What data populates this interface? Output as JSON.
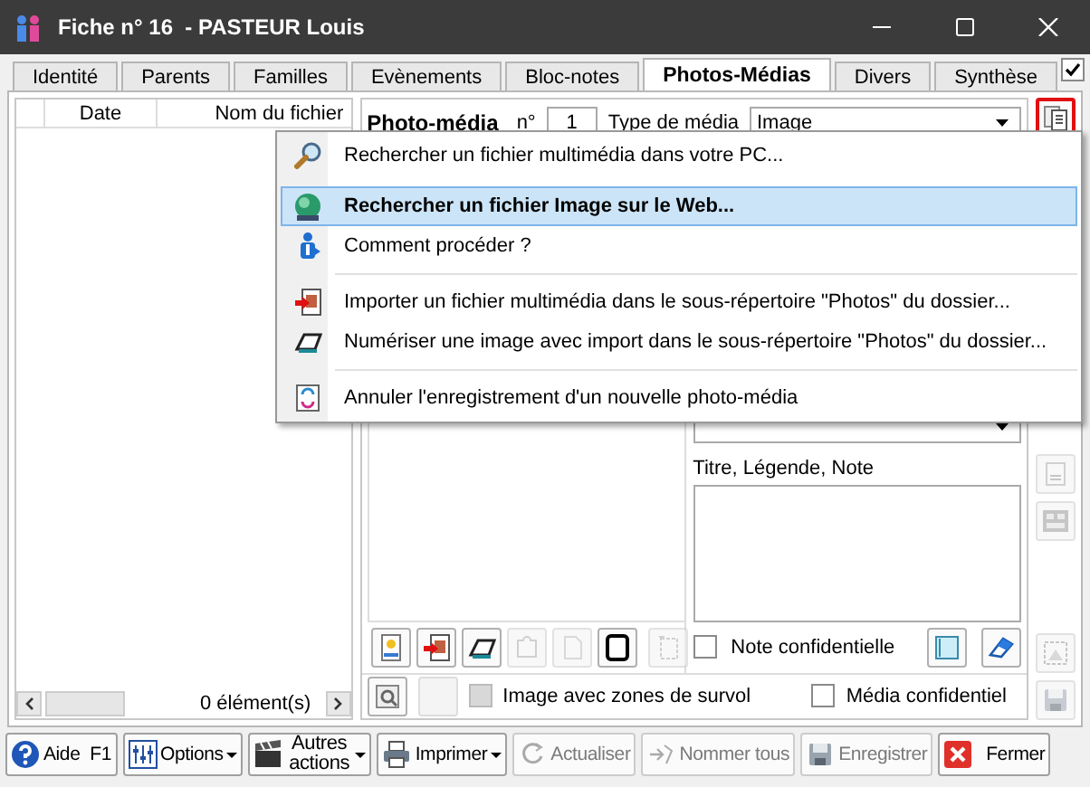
{
  "window": {
    "title": "Fiche n° 16  - PASTEUR Louis"
  },
  "tabs": [
    {
      "label": "Identité",
      "selected": false
    },
    {
      "label": "Parents",
      "selected": false
    },
    {
      "label": "Familles",
      "selected": false
    },
    {
      "label": "Evènements",
      "selected": false
    },
    {
      "label": "Bloc-notes",
      "selected": false
    },
    {
      "label": "Photos-Médias",
      "selected": true
    },
    {
      "label": "Divers",
      "selected": false
    },
    {
      "label": "Synthèse",
      "selected": false
    }
  ],
  "top_checkbox": {
    "checked": true
  },
  "list": {
    "columns": [
      "Date",
      "Nom du fichier"
    ],
    "count": "0 élément(s)"
  },
  "media": {
    "title": "Photo-média",
    "number_label": "n°",
    "number": "1",
    "type_label": "Type de média",
    "type_value": "Image",
    "caption_label": "Titre, Légende, Note",
    "note_confidential": {
      "label": "Note confidentielle",
      "checked": false
    },
    "hover_zones": {
      "label": "Image avec zones de survol",
      "checked": false,
      "disabled": true
    },
    "media_confidential": {
      "label": "Média confidentiel",
      "checked": false
    }
  },
  "image_tools": [
    {
      "kind": "new-image",
      "disabled": false
    },
    {
      "kind": "import",
      "disabled": false
    },
    {
      "kind": "scanner",
      "disabled": false
    },
    {
      "kind": "puzzle",
      "disabled": true
    },
    {
      "kind": "page",
      "disabled": true
    },
    {
      "kind": "frame",
      "disabled": false
    },
    {
      "kind": "rotate",
      "disabled": true
    }
  ],
  "side_tools": [
    {
      "kind": "copy",
      "disabled": false,
      "active": true
    },
    {
      "kind": "list",
      "disabled": true,
      "active": false
    },
    {
      "kind": "gallery",
      "disabled": true,
      "active": false
    },
    {
      "kind": "select-image",
      "disabled": true,
      "active": false
    },
    {
      "kind": "save",
      "disabled": true,
      "active": false
    }
  ],
  "menu": {
    "items": [
      {
        "kind": "search",
        "label": "Rechercher un fichier multimédia dans votre PC...",
        "selected": false,
        "separator_before": false
      },
      {
        "kind": "globe",
        "label": "Rechercher un fichier Image sur le Web...",
        "selected": true,
        "separator_before": false
      },
      {
        "kind": "info",
        "label": "Comment procéder ?",
        "selected": false,
        "separator_before": false
      },
      {
        "kind": "import",
        "label": "Importer un fichier multimédia dans le sous-répertoire \"Photos\" du dossier...",
        "selected": false,
        "separator_before": true
      },
      {
        "kind": "scanner",
        "label": "Numériser une image avec import dans le sous-répertoire \"Photos\" du dossier...",
        "selected": false,
        "separator_before": false
      },
      {
        "kind": "cancel",
        "label": "Annuler l'enregistrement d'un nouvelle photo-média",
        "selected": false,
        "separator_before": true
      }
    ]
  },
  "buttons": [
    {
      "kind": "help",
      "label": "Aide",
      "shortcut": "F1",
      "dropdown": false,
      "disabled": false
    },
    {
      "kind": "options",
      "label": "Options",
      "dropdown": true,
      "disabled": false
    },
    {
      "kind": "actions",
      "label": "Autres actions",
      "dropdown": true,
      "disabled": false
    },
    {
      "kind": "print",
      "label": "Imprimer",
      "dropdown": true,
      "disabled": false
    },
    {
      "kind": "refresh",
      "label": "Actualiser",
      "dropdown": false,
      "disabled": true
    },
    {
      "kind": "rename",
      "label": "Nommer tous",
      "dropdown": false,
      "disabled": true
    },
    {
      "kind": "save",
      "label": "Enregistrer",
      "dropdown": false,
      "disabled": true
    },
    {
      "kind": "close",
      "label": "Fermer",
      "dropdown": false,
      "disabled": false
    }
  ]
}
